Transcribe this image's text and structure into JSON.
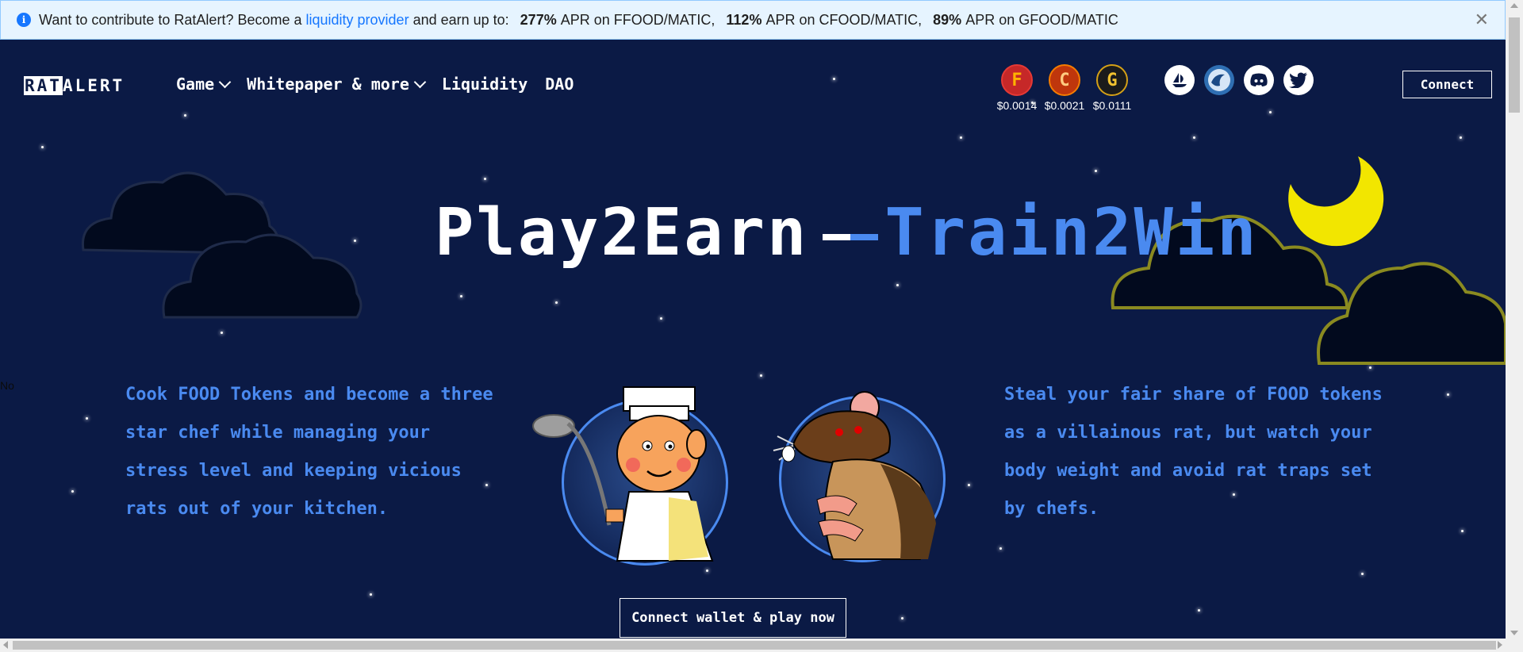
{
  "banner": {
    "text_before": "Want to contribute to RatAlert? Become a",
    "link": "liquidity provider",
    "text_after": "and earn up to:",
    "aprs": [
      {
        "value": "277%",
        "pair": "APR on FFOOD/MATIC,"
      },
      {
        "value": "112%",
        "pair": "APR on CFOOD/MATIC,"
      },
      {
        "value": "89%",
        "pair": "APR on GFOOD/MATIC"
      }
    ],
    "close_icon": "close-icon"
  },
  "nav": {
    "logo_inv": "RAT",
    "logo_rest": "ALERT",
    "items": [
      {
        "label": "Game",
        "dropdown": true
      },
      {
        "label": "Whitepaper & more",
        "dropdown": true
      },
      {
        "label": "Liquidity",
        "dropdown": false
      },
      {
        "label": "DAO",
        "dropdown": false
      }
    ]
  },
  "tokens": [
    {
      "letter": "F",
      "price": "$0.0014",
      "color": "#e53935"
    },
    {
      "letter": "C",
      "price": "$0.0021",
      "color": "#f57c00"
    },
    {
      "letter": "G",
      "price": "$0.0111",
      "color": "#d4a017"
    }
  ],
  "socials": [
    "opensea-icon",
    "swap-icon",
    "discord-icon",
    "twitter-icon"
  ],
  "connect_label": "Connect",
  "hero": {
    "part1": "Play2Earn",
    "part2": "Train2Win"
  },
  "left_text": "Cook FOOD Tokens and become a three star chef while managing your stress level and keeping vicious rats out of your kitchen.",
  "right_text": "Steal your fair share of FOOD tokens as a villainous rat, but watch your body weight and avoid rat traps set by chefs.",
  "cta_label": "Connect wallet & play now",
  "side_no": "No"
}
